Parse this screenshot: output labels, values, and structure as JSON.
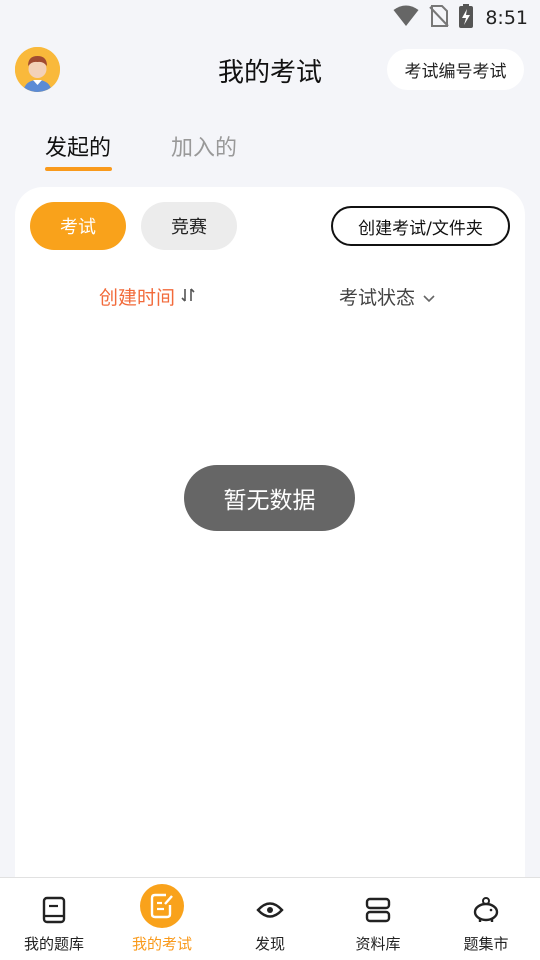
{
  "status_bar": {
    "time": "8:51"
  },
  "header": {
    "title": "我的考试",
    "exam_code_button": "考试编号考试"
  },
  "tabs": [
    {
      "label": "发起的",
      "active": true
    },
    {
      "label": "加入的",
      "active": false
    }
  ],
  "filters": {
    "exam": "考试",
    "contest": "竞赛",
    "create_button": "创建考试/文件夹"
  },
  "sort": {
    "created_time": "创建时间",
    "exam_status": "考试状态"
  },
  "empty_message": "暂无数据",
  "bottom_nav": [
    {
      "label": "我的题库",
      "icon": "book-icon",
      "active": false
    },
    {
      "label": "我的考试",
      "icon": "exam-edit-icon",
      "active": true
    },
    {
      "label": "发现",
      "icon": "eye-icon",
      "active": false
    },
    {
      "label": "资料库",
      "icon": "stacked-books-icon",
      "active": false
    },
    {
      "label": "题集市",
      "icon": "piggy-bank-icon",
      "active": false
    }
  ],
  "colors": {
    "accent": "#f9a21b",
    "sort_active": "#f26a3a",
    "toast": "#666666",
    "background": "#f4f5f9"
  }
}
